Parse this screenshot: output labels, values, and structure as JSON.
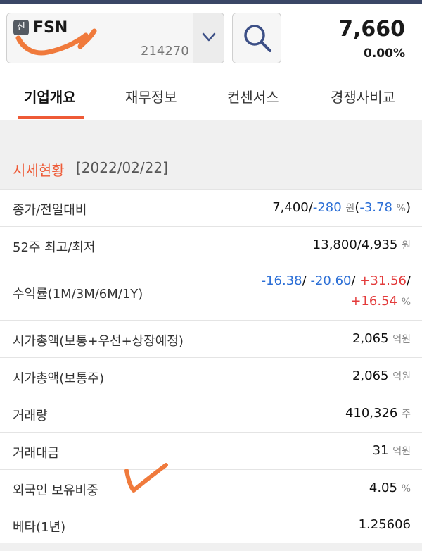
{
  "header": {
    "badge": "신",
    "stock_name": "FSN",
    "stock_code": "214270",
    "price": "7,660",
    "change_pct": "0.00%",
    "icons": {
      "dropdown": "chevron-down-icon",
      "search": "search-icon"
    }
  },
  "tabs": [
    {
      "label": "기업개요",
      "active": true
    },
    {
      "label": "재무정보",
      "active": false
    },
    {
      "label": "컨센서스",
      "active": false
    },
    {
      "label": "경쟁사비교",
      "active": false
    }
  ],
  "section": {
    "title": "시세현황",
    "date": "[2022/02/22]"
  },
  "rows": {
    "close": {
      "label": "종가/전일대비",
      "price": "7,400/",
      "diff": "-280",
      "unit": "원",
      "pct_open": "(",
      "pct": "-3.78",
      "pct_unit": "%",
      "pct_close": ")"
    },
    "w52": {
      "label": "52주 최고/최저",
      "value": "13,800/4,935",
      "unit": "원"
    },
    "returns": {
      "label": "수익률(1M/3M/6M/1Y)",
      "r1m": "-16.38",
      "r3m": "-20.60",
      "r6m": "+31.56",
      "r1y": "+16.54",
      "sep": "/",
      "unit": "%"
    },
    "mcap_all": {
      "label": "시가총액(보통+우선+상장예정)",
      "value": "2,065",
      "unit": "억원"
    },
    "mcap_common": {
      "label": "시가총액(보통주)",
      "value": "2,065",
      "unit": "억원"
    },
    "volume": {
      "label": "거래량",
      "value": "410,326",
      "unit": "주"
    },
    "amount": {
      "label": "거래대금",
      "value": "31",
      "unit": "억원"
    },
    "foreign": {
      "label": "외국인 보유비중",
      "value": "4.05",
      "unit": "%"
    },
    "beta": {
      "label": "베타(1년)",
      "value": "1.25606"
    }
  },
  "colors": {
    "accent": "#ee5a36",
    "up": "#e33b3b",
    "down": "#2c6fd6",
    "annotation": "#f07a3c"
  }
}
